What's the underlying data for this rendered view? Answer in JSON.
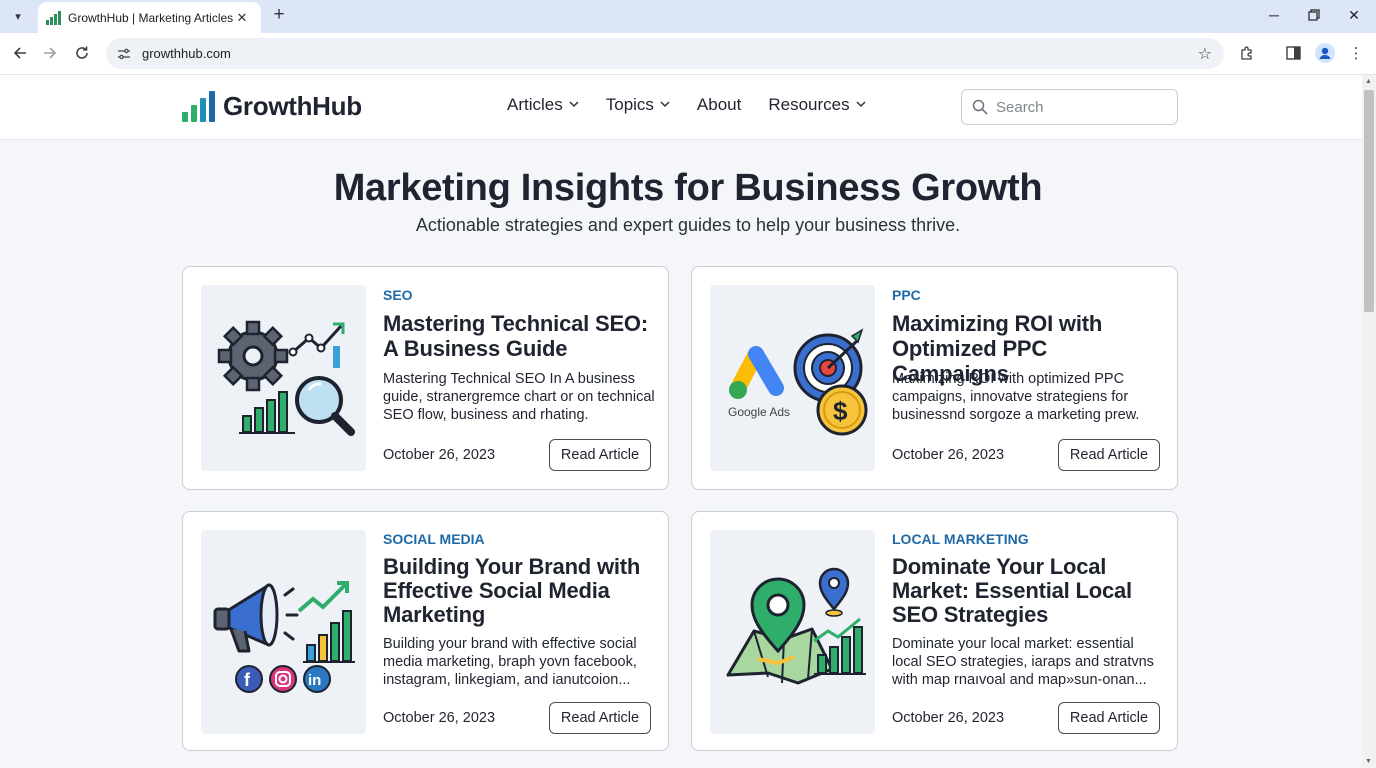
{
  "browser": {
    "tab_title": "GrowthHub | Marketing Articles",
    "url": "growthhub.com"
  },
  "site": {
    "logo_text": "GrowthHub",
    "nav": [
      {
        "label": "Articles",
        "has_dropdown": true
      },
      {
        "label": "Topics",
        "has_dropdown": true
      },
      {
        "label": "About",
        "has_dropdown": false
      },
      {
        "label": "Resources",
        "has_dropdown": true
      }
    ],
    "search_placeholder": "Search"
  },
  "hero": {
    "title": "Marketing Insights for Business Growth",
    "subtitle": "Actionable strategies and expert guides to help your business thrive."
  },
  "articles": [
    {
      "category": "SEO",
      "title": "Mastering Technical SEO: A Business Guide",
      "description": "Mastering Technical SEO In A business guide, stranergremce chart or on technical SEO flow, business and rhating.",
      "date": "October 26, 2023",
      "button": "Read Article",
      "icon": "seo-gear-chart-magnifier-icon"
    },
    {
      "category": "PPC",
      "title": "Maximizing ROI with Optimized PPC Campaigns",
      "description": "Maximizing ROI with optimized PPC campaigns, innovatve strategiens for businessnd sorgoze a marketing prew.",
      "date": "October 26, 2023",
      "button": "Read Article",
      "icon": "google-ads-target-coin-icon",
      "thumb_label": "Google Ads"
    },
    {
      "category": "SOCIAL MEDIA",
      "title": "Building Your Brand with Effective Social Media Marketing",
      "description": "Building your brand with effective social media marketing, braph yovn facebook, instagram, linkegiam, and ianutcoion...",
      "date": "October 26, 2023",
      "button": "Read Article",
      "icon": "megaphone-social-icon"
    },
    {
      "category": "LOCAL MARKETING",
      "title": "Dominate Your Local Market: Essential Local SEO Strategies",
      "description": "Dominate your local market: essential local SEO strategies, iaraps and stratvns with map rnaıvoal and map»sun-onan...",
      "date": "October 26, 2023",
      "button": "Read Article",
      "icon": "map-pin-chart-icon"
    }
  ],
  "colors": {
    "category": "#1f6aa6",
    "logo_bars": [
      "#2fae6b",
      "#2fae6b",
      "#1f8fb8",
      "#1f6aa6"
    ]
  }
}
